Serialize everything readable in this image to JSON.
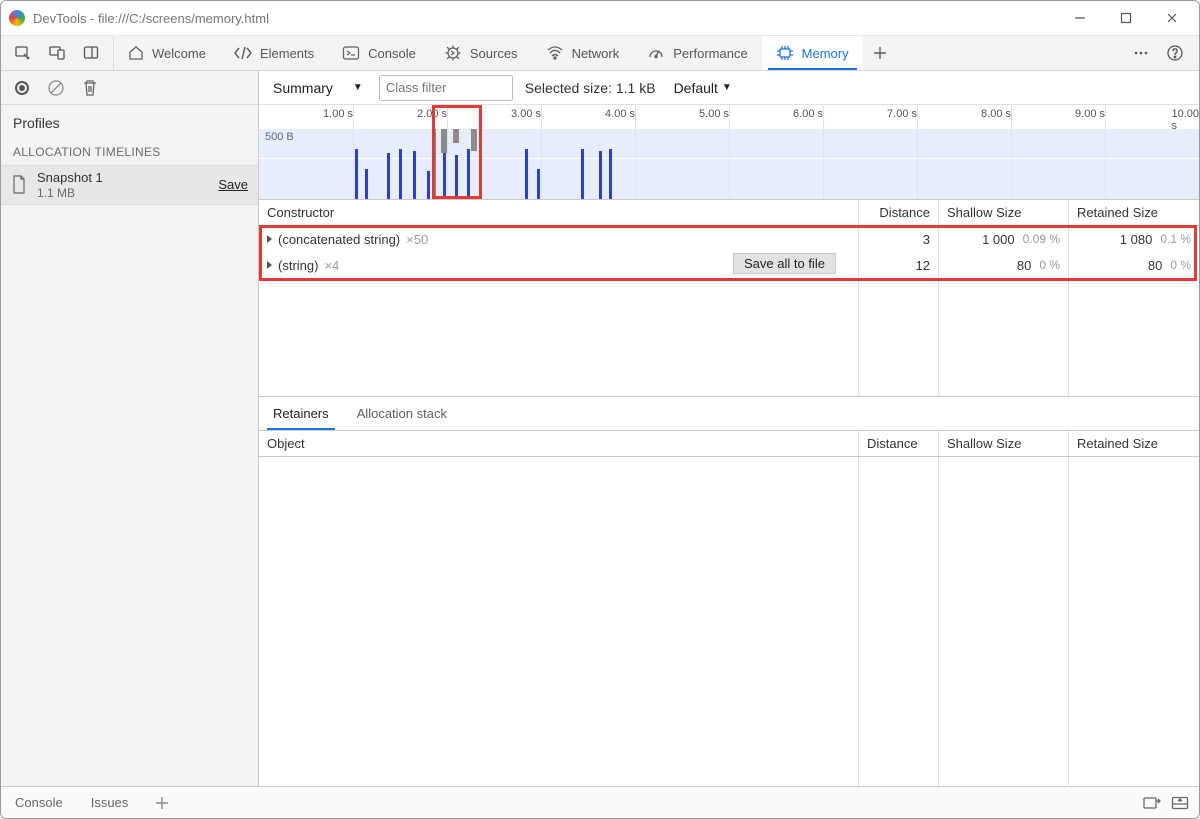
{
  "titlebar": {
    "title": "DevTools - file:///C:/screens/memory.html"
  },
  "tabs": {
    "welcome": "Welcome",
    "elements": "Elements",
    "console": "Console",
    "sources": "Sources",
    "network": "Network",
    "performance": "Performance",
    "memory": "Memory"
  },
  "sidebar": {
    "profiles_label": "Profiles",
    "group_label": "ALLOCATION TIMELINES",
    "snapshot": {
      "name": "Snapshot 1",
      "size": "1.1 MB",
      "save": "Save"
    }
  },
  "toolbar": {
    "view": "Summary",
    "filter_placeholder": "Class filter",
    "selected_size": "Selected size: 1.1 kB",
    "retention": "Default"
  },
  "timeline": {
    "ylabel": "500 B",
    "ticks": [
      "1.00 s",
      "2.00 s",
      "3.00 s",
      "4.00 s",
      "5.00 s",
      "6.00 s",
      "7.00 s",
      "8.00 s",
      "9.00 s",
      "10.00 s"
    ]
  },
  "ctable": {
    "headers": {
      "constructor": "Constructor",
      "distance": "Distance",
      "shallow": "Shallow Size",
      "retained": "Retained Size"
    },
    "rows": [
      {
        "name": "(concatenated string)",
        "mult": "×50",
        "distance": "3",
        "shallow": "1 000",
        "shallow_pct": "0.09 %",
        "retained": "1 080",
        "retained_pct": "0.1 %"
      },
      {
        "name": "(string)",
        "mult": "×4",
        "distance": "12",
        "shallow": "80",
        "shallow_pct": "0 %",
        "retained": "80",
        "retained_pct": "0 %"
      }
    ],
    "chip": "Save all to file"
  },
  "subtabs": {
    "retainers": "Retainers",
    "allocation": "Allocation stack"
  },
  "rtable": {
    "headers": {
      "object": "Object",
      "distance": "Distance",
      "shallow": "Shallow Size",
      "retained": "Retained Size"
    }
  },
  "bottom": {
    "console": "Console",
    "issues": "Issues"
  }
}
